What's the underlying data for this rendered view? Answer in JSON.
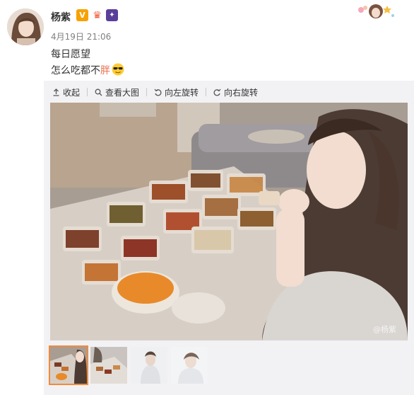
{
  "post": {
    "username": "杨紫",
    "badge_v": "V",
    "time": "4月19日 21:06",
    "text_line1": "每日愿望",
    "text_line2_prefix": "怎么吃都不",
    "text_line2_highlight": "胖",
    "emoji": "cool-sunglasses-icon"
  },
  "toolbar": {
    "collapse": "收起",
    "view_large": "查看大图",
    "rotate_left": "向左旋转",
    "rotate_right": "向右旋转"
  },
  "photo": {
    "watermark": "@杨紫"
  },
  "thumbnails": [
    {
      "label": "thumbnail-1",
      "active": true
    },
    {
      "label": "thumbnail-2",
      "active": false
    },
    {
      "label": "thumbnail-3",
      "active": false
    },
    {
      "label": "thumbnail-4",
      "active": false
    }
  ],
  "colors": {
    "accent": "#eb7350",
    "panel_bg": "#f2f2f5",
    "active_border": "#f28a3a"
  }
}
